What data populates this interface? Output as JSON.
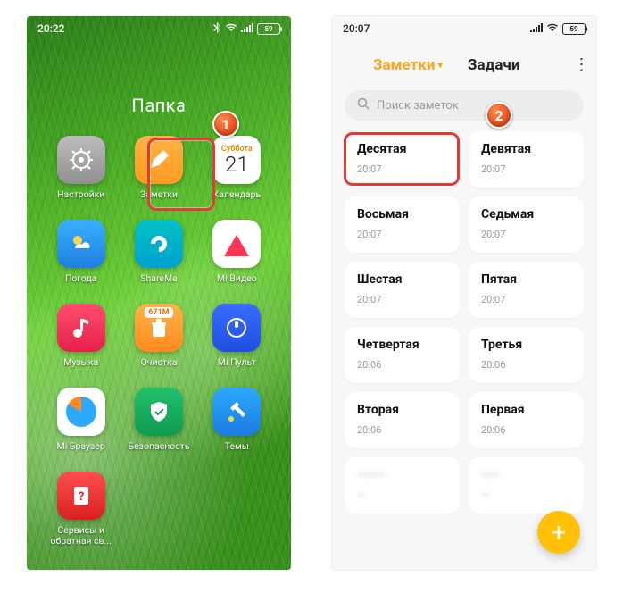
{
  "left": {
    "status": {
      "time": "20:22",
      "battery": "59"
    },
    "folder_title": "Папка",
    "calendar": {
      "dow": "Суббота",
      "day": "21"
    },
    "clean_badge": "671M",
    "apps": [
      {
        "key": "settings",
        "label": "Настройки"
      },
      {
        "key": "notes",
        "label": "Заметки"
      },
      {
        "key": "calendar",
        "label": "Календарь"
      },
      {
        "key": "weather",
        "label": "Погода"
      },
      {
        "key": "shareme",
        "label": "ShareMe"
      },
      {
        "key": "video",
        "label": "Mi Видео"
      },
      {
        "key": "music",
        "label": "Музыка"
      },
      {
        "key": "clean",
        "label": "Очистка"
      },
      {
        "key": "remote",
        "label": "Mi Пульт"
      },
      {
        "key": "browser",
        "label": "Mi Браузер"
      },
      {
        "key": "security",
        "label": "Безопасность"
      },
      {
        "key": "themes",
        "label": "Темы"
      },
      {
        "key": "services",
        "label": "Сервисы и обратная св..."
      }
    ]
  },
  "right": {
    "status": {
      "time": "20:07",
      "battery": "59"
    },
    "tabs": {
      "notes": "Заметки",
      "tasks": "Задачи"
    },
    "search_placeholder": "Поиск заметок",
    "notes": [
      {
        "title": "Десятая",
        "time": "20:07"
      },
      {
        "title": "Девятая",
        "time": "20:07"
      },
      {
        "title": "Восьмая",
        "time": "20:07"
      },
      {
        "title": "Седьмая",
        "time": "20:07"
      },
      {
        "title": "Шестая",
        "time": "20:07"
      },
      {
        "title": "Пятая",
        "time": "20:07"
      },
      {
        "title": "Четвертая",
        "time": "20:06"
      },
      {
        "title": "Третья",
        "time": "20:06"
      },
      {
        "title": "Вторая",
        "time": "20:06"
      },
      {
        "title": "Первая",
        "time": "20:06"
      },
      {
        "title": "———",
        "time": "—",
        "blurred": true
      },
      {
        "title": "——",
        "time": "—",
        "blurred": true
      }
    ]
  },
  "callouts": {
    "one": "1",
    "two": "2"
  }
}
